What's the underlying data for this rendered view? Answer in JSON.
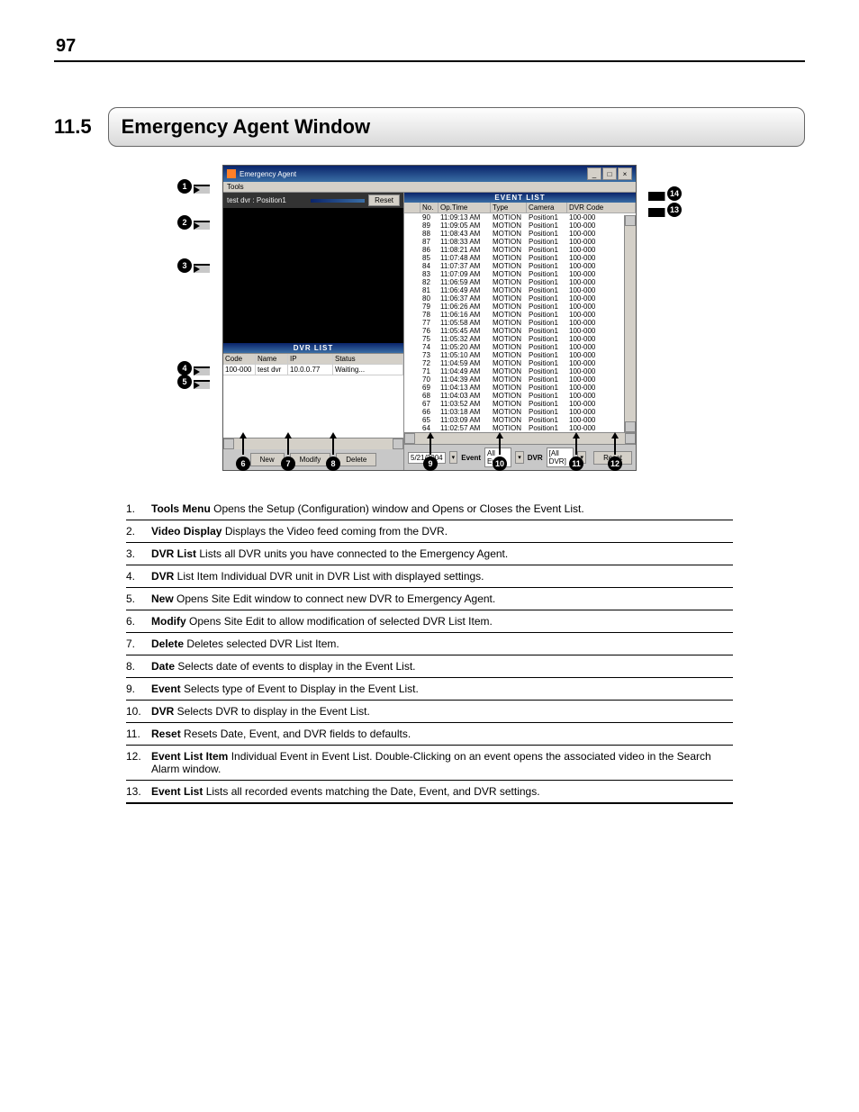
{
  "page": {
    "number": "97"
  },
  "section": {
    "number": "11.5",
    "title": "Emergency Agent Window"
  },
  "app": {
    "title": "Emergency Agent",
    "menu": {
      "tools": "Tools"
    },
    "video": {
      "header": "test dvr : Position1",
      "reset": "Reset"
    },
    "dvr": {
      "title": "DVR LIST",
      "headers": {
        "code": "Code",
        "name": "Name",
        "ip": "IP",
        "status": "Status"
      },
      "row": {
        "code": "100-000",
        "name": "test dvr",
        "ip": "10.0.0.77",
        "status": "Waiting..."
      }
    },
    "buttons": {
      "new": "New",
      "modify": "Modify",
      "delete": "Delete"
    },
    "events": {
      "title": "EVENT LIST",
      "headers": {
        "blank": "",
        "no": "No.",
        "time": "Op.Time",
        "type": "Type",
        "camera": "Camera",
        "code": "DVR Code"
      },
      "rows": [
        {
          "no": "90",
          "time": "11:09:13 AM",
          "type": "MOTION",
          "camera": "Position1",
          "code": "100-000"
        },
        {
          "no": "89",
          "time": "11:09:05 AM",
          "type": "MOTION",
          "camera": "Position1",
          "code": "100-000"
        },
        {
          "no": "88",
          "time": "11:08:43 AM",
          "type": "MOTION",
          "camera": "Position1",
          "code": "100-000"
        },
        {
          "no": "87",
          "time": "11:08:33 AM",
          "type": "MOTION",
          "camera": "Position1",
          "code": "100-000"
        },
        {
          "no": "86",
          "time": "11:08:21 AM",
          "type": "MOTION",
          "camera": "Position1",
          "code": "100-000"
        },
        {
          "no": "85",
          "time": "11:07:48 AM",
          "type": "MOTION",
          "camera": "Position1",
          "code": "100-000"
        },
        {
          "no": "84",
          "time": "11:07:37 AM",
          "type": "MOTION",
          "camera": "Position1",
          "code": "100-000"
        },
        {
          "no": "83",
          "time": "11:07:09 AM",
          "type": "MOTION",
          "camera": "Position1",
          "code": "100-000"
        },
        {
          "no": "82",
          "time": "11:06:59 AM",
          "type": "MOTION",
          "camera": "Position1",
          "code": "100-000"
        },
        {
          "no": "81",
          "time": "11:06:49 AM",
          "type": "MOTION",
          "camera": "Position1",
          "code": "100-000"
        },
        {
          "no": "80",
          "time": "11:06:37 AM",
          "type": "MOTION",
          "camera": "Position1",
          "code": "100-000"
        },
        {
          "no": "79",
          "time": "11:06:26 AM",
          "type": "MOTION",
          "camera": "Position1",
          "code": "100-000"
        },
        {
          "no": "78",
          "time": "11:06:16 AM",
          "type": "MOTION",
          "camera": "Position1",
          "code": "100-000"
        },
        {
          "no": "77",
          "time": "11:05:58 AM",
          "type": "MOTION",
          "camera": "Position1",
          "code": "100-000"
        },
        {
          "no": "76",
          "time": "11:05:45 AM",
          "type": "MOTION",
          "camera": "Position1",
          "code": "100-000"
        },
        {
          "no": "75",
          "time": "11:05:32 AM",
          "type": "MOTION",
          "camera": "Position1",
          "code": "100-000"
        },
        {
          "no": "74",
          "time": "11:05:20 AM",
          "type": "MOTION",
          "camera": "Position1",
          "code": "100-000"
        },
        {
          "no": "73",
          "time": "11:05:10 AM",
          "type": "MOTION",
          "camera": "Position1",
          "code": "100-000"
        },
        {
          "no": "72",
          "time": "11:04:59 AM",
          "type": "MOTION",
          "camera": "Position1",
          "code": "100-000"
        },
        {
          "no": "71",
          "time": "11:04:49 AM",
          "type": "MOTION",
          "camera": "Position1",
          "code": "100-000"
        },
        {
          "no": "70",
          "time": "11:04:39 AM",
          "type": "MOTION",
          "camera": "Position1",
          "code": "100-000"
        },
        {
          "no": "69",
          "time": "11:04:13 AM",
          "type": "MOTION",
          "camera": "Position1",
          "code": "100-000"
        },
        {
          "no": "68",
          "time": "11:04:03 AM",
          "type": "MOTION",
          "camera": "Position1",
          "code": "100-000"
        },
        {
          "no": "67",
          "time": "11:03:52 AM",
          "type": "MOTION",
          "camera": "Position1",
          "code": "100-000"
        },
        {
          "no": "66",
          "time": "11:03:18 AM",
          "type": "MOTION",
          "camera": "Position1",
          "code": "100-000"
        },
        {
          "no": "65",
          "time": "11:03:09 AM",
          "type": "MOTION",
          "camera": "Position1",
          "code": "100-000"
        },
        {
          "no": "64",
          "time": "11:02:57 AM",
          "type": "MOTION",
          "camera": "Position1",
          "code": "100-000"
        }
      ]
    },
    "filter": {
      "date": "5/21/2004",
      "event_label": "Event",
      "event_value": "All Event",
      "dvr_label": "DVR",
      "dvr_value": "[All DVR]",
      "reset": "Reset"
    }
  },
  "legend": [
    {
      "n": "1.",
      "b": "Tools Menu",
      "t": " Opens the Setup (Configuration) window and Opens or Closes the Event List."
    },
    {
      "n": "2.",
      "b": "Video Display",
      "t": " Displays the Video feed coming from the DVR."
    },
    {
      "n": "3.",
      "b": "DVR List",
      "t": " Lists all DVR units you have connected to the Emergency Agent."
    },
    {
      "n": "4.",
      "b": "DVR",
      "t": " List Item Individual DVR unit in DVR List with displayed settings."
    },
    {
      "n": "5.",
      "b": "New",
      "t": " Opens Site Edit window to connect new DVR to Emergency Agent."
    },
    {
      "n": "6.",
      "b": "Modify",
      "t": " Opens Site Edit to allow modification of selected DVR List Item."
    },
    {
      "n": "7.",
      "b": "Delete",
      "t": " Deletes selected DVR List Item."
    },
    {
      "n": "8.",
      "b": "Date",
      "t": " Selects date of events to display in the Event List."
    },
    {
      "n": "9.",
      "b": "Event",
      "t": " Selects type of Event to Display in the Event List."
    },
    {
      "n": "10.",
      "b": "DVR",
      "t": " Selects DVR to display in the Event List."
    },
    {
      "n": "11.",
      "b": "Reset",
      "t": " Resets Date, Event, and DVR fields to defaults."
    },
    {
      "n": "12.",
      "b": "Event List Item",
      "t": " Individual Event in Event List. Double-Clicking on an event opens the associated video in the Search Alarm window."
    },
    {
      "n": "13.",
      "b": "Event List",
      "t": " Lists all recorded events matching the Date, Event, and DVR settings."
    }
  ],
  "callouts": [
    "1",
    "2",
    "3",
    "4",
    "5",
    "6",
    "7",
    "8",
    "9",
    "10",
    "11",
    "12",
    "13",
    "14"
  ]
}
